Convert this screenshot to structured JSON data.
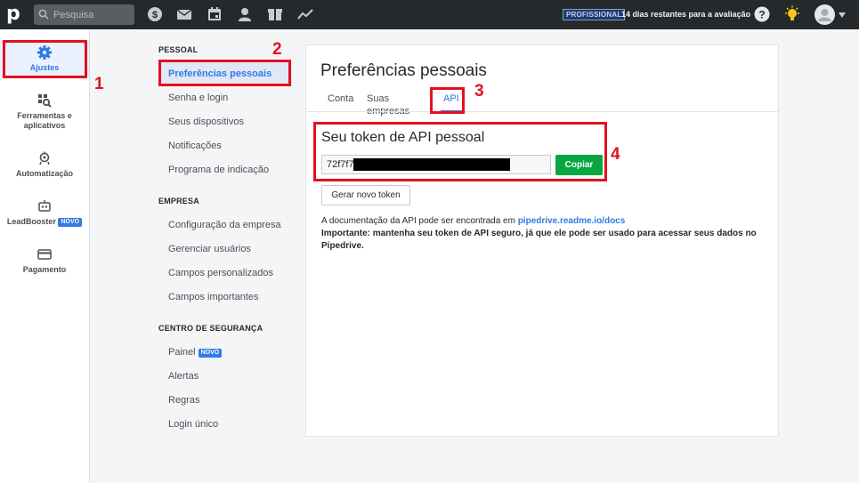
{
  "topbar": {
    "logo": "p",
    "search_placeholder": "Pesquisa",
    "nav_icons": [
      "deals-icon",
      "mail-icon",
      "calendar-icon",
      "contacts-icon",
      "products-icon",
      "insights-icon"
    ],
    "plan_badge": "PROFISSIONAL",
    "trial_text": "14 dias restantes para a avaliação"
  },
  "sidebar": {
    "items": [
      {
        "label": "Ajustes",
        "icon": "gear-icon",
        "active": true
      },
      {
        "label": "Ferramentas e aplicativos",
        "icon": "tools-icon"
      },
      {
        "label": "Automatização",
        "icon": "automation-icon"
      },
      {
        "label": "LeadBooster",
        "icon": "robot-icon",
        "badge": "NOVO"
      },
      {
        "label": "Pagamento",
        "icon": "card-icon"
      }
    ]
  },
  "menu": {
    "sections": [
      {
        "title": "PESSOAL",
        "items": [
          "Preferências pessoais",
          "Senha e login",
          "Seus dispositivos",
          "Notificações",
          "Programa de indicação"
        ]
      },
      {
        "title": "EMPRESA",
        "items": [
          "Configuração da empresa",
          "Gerenciar usuários",
          "Campos personalizados",
          "Campos importantes"
        ]
      },
      {
        "title": "CENTRO DE SEGURANÇA",
        "items": [
          "Painel",
          "Alertas",
          "Regras",
          "Login único"
        ]
      }
    ],
    "painel_badge": "NOVO",
    "active_item": "Preferências pessoais"
  },
  "panel": {
    "title": "Preferências pessoais",
    "tabs": [
      "Conta",
      "Suas empresas",
      "API"
    ],
    "active_tab": "API",
    "token_title": "Seu token de API pessoal",
    "token_value": "72f7f7",
    "copy_label": "Copiar",
    "generate_label": "Gerar novo token",
    "doc_text": "A documentação da API pode ser encontrada em ",
    "doc_link": "pipedrive.readme.io/docs",
    "warning": "Importante: mantenha seu token de API seguro, já que ele pode ser usado para acessar seus dados no Pipedrive."
  },
  "annotations": [
    "1",
    "2",
    "3",
    "4"
  ],
  "colors": {
    "topbar": "#26292c",
    "accent": "#317ae2",
    "copy_button": "#08a742",
    "annotation": "#e3101e"
  }
}
